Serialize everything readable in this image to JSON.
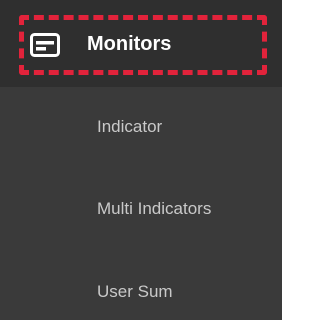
{
  "header": {
    "title": "Monitors",
    "icon": "monitor-panel-icon",
    "highlight_color": "#e2233b"
  },
  "menu": {
    "items": [
      {
        "label": "Indicator"
      },
      {
        "label": "Multi Indicators"
      },
      {
        "label": "User Sum"
      }
    ]
  },
  "colors": {
    "panel_background": "#3a3a3a",
    "header_background": "#2f2f2f",
    "item_text": "#c9c9c9"
  }
}
